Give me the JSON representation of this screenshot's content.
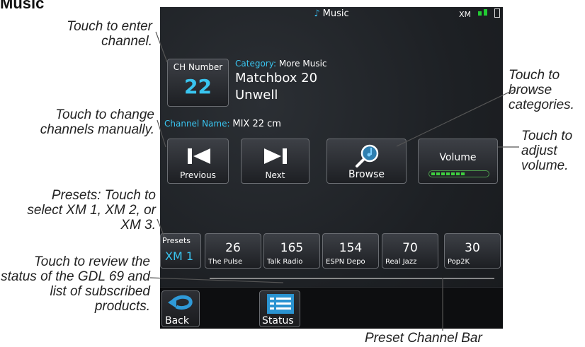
{
  "page_title": "Music",
  "callouts": {
    "enter_channel": "Touch to enter channel.",
    "change_channels": "Touch to change channels manually.",
    "presets": "Presets: Touch to select XM 1, XM 2, or XM 3.",
    "review_status": "Touch to review the status of the GDL 69 and list of subscribed products.",
    "browse_categories": "Touch to browse categories.",
    "adjust_volume": "Touch to adjust volume.",
    "preset_channel_bar": "Preset Channel Bar"
  },
  "screen": {
    "title": "Music",
    "xm_label": "XM",
    "ch_number_label": "CH Number",
    "ch_number": "22",
    "category_label": "Category:",
    "category_value": "More Music",
    "artist": "Matchbox 20",
    "song": "Unwell",
    "channel_name_label": "Channel Name:",
    "channel_name_value": "MIX 22 cm",
    "buttons": {
      "previous": "Previous",
      "next": "Next",
      "browse": "Browse",
      "volume": "Volume"
    },
    "volume_level": 0.6,
    "presets_label": "Presets",
    "presets_value": "XM 1",
    "presets": [
      {
        "num": "26",
        "name": "The Pulse"
      },
      {
        "num": "165",
        "name": "Talk Radio"
      },
      {
        "num": "154",
        "name": "ESPN Depo"
      },
      {
        "num": "70",
        "name": "Real Jazz"
      },
      {
        "num": "30",
        "name": "Pop2K"
      }
    ],
    "back_label": "Back",
    "status_label": "Status"
  },
  "colors": {
    "accent": "#39c5f0",
    "signal": "#22cc33"
  }
}
